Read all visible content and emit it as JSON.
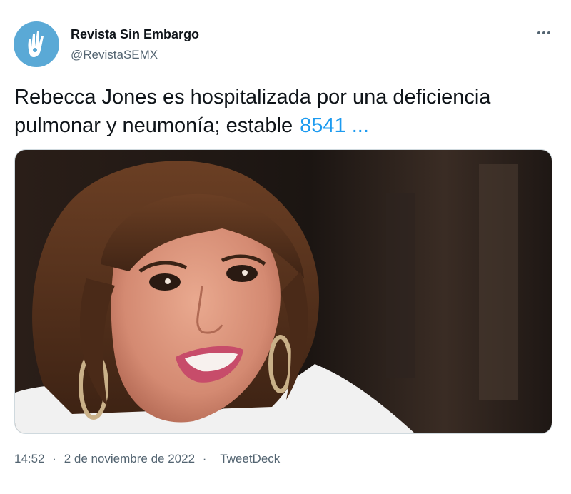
{
  "account": {
    "name": "Revista Sin Embargo",
    "handle": "@RevistaSEMX",
    "avatar_icon": "hand-logo-icon",
    "avatar_color": "#5aa9d6"
  },
  "tweet": {
    "text_line1": "Rebecca Jones es hospitalizada por una deficiencia",
    "text_line2": "pulmonar y neumonía;  estable",
    "link_text": "8541 ...",
    "link_color": "#1d9bf0"
  },
  "media": {
    "icon": "photo-woman-smiling"
  },
  "meta": {
    "time": "14:52",
    "date": "2 de noviembre de 2022",
    "separator": "·",
    "source": "TweetDeck"
  },
  "menu": {
    "icon": "more-options-icon"
  }
}
